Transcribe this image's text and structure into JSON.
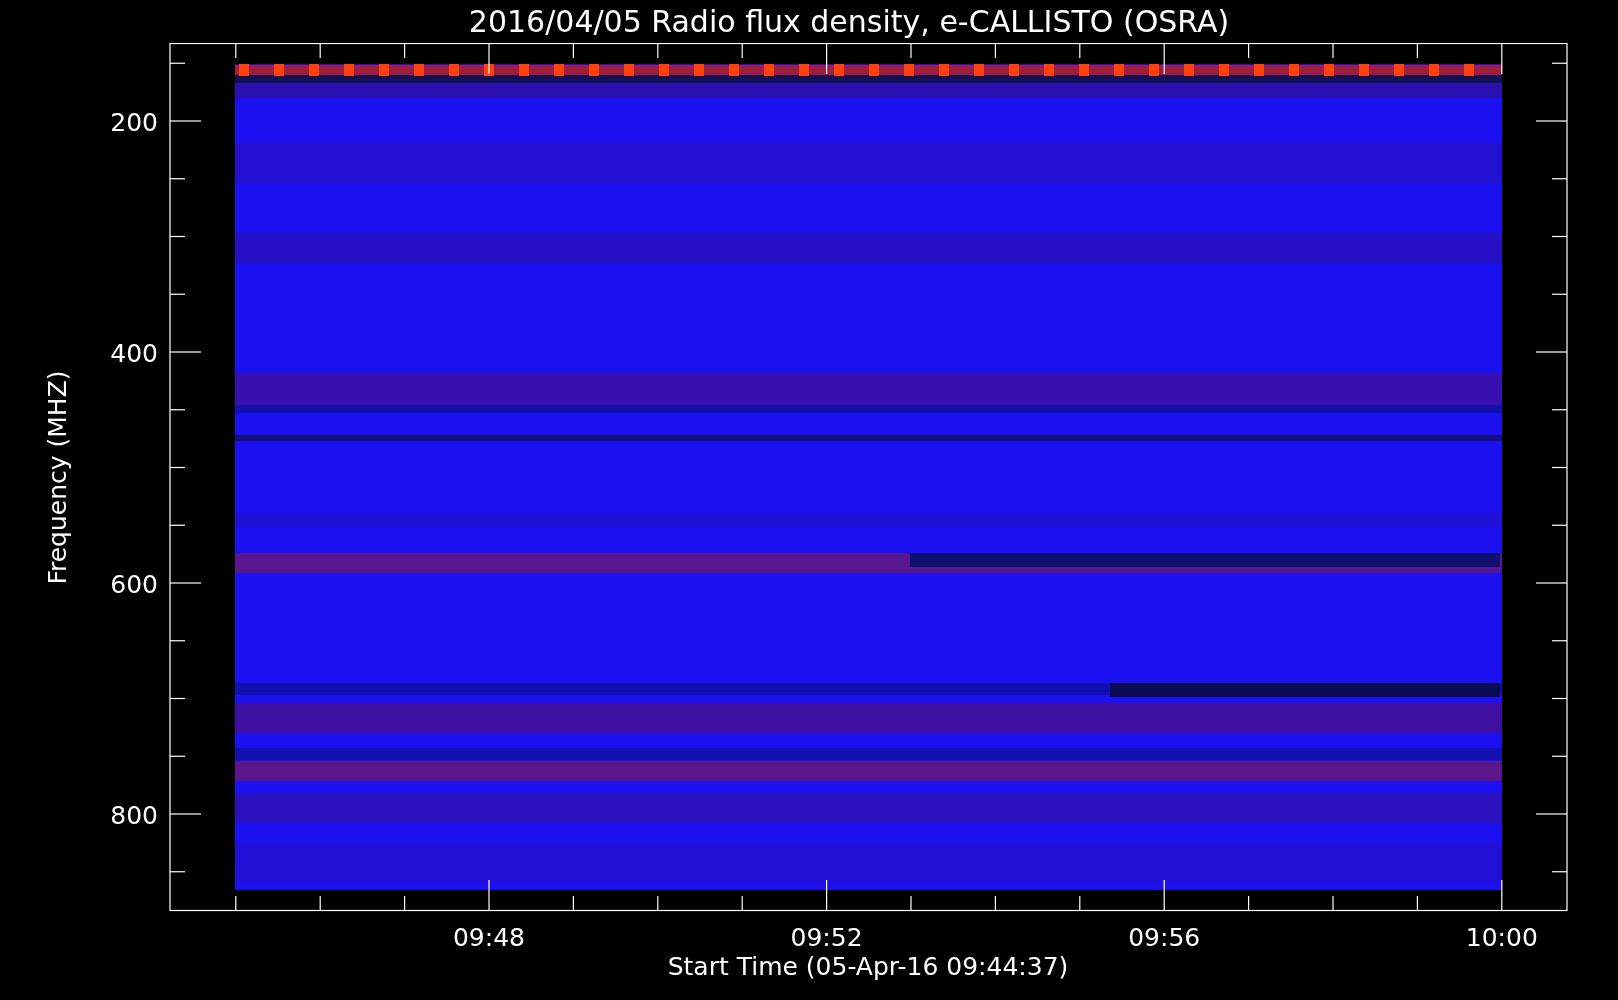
{
  "plot": {
    "title": "2016/04/05  Radio flux density, e-CALLISTO (OSRA)",
    "y_axis": {
      "label": "Frequency (MHZ)",
      "ticks": [
        "200",
        "400",
        "600",
        "800"
      ]
    },
    "x_axis": {
      "label": "Start Time (05-Apr-16 09:44:37)",
      "ticks": [
        "09:48",
        "09:52",
        "09:56",
        "10:00"
      ]
    }
  }
}
